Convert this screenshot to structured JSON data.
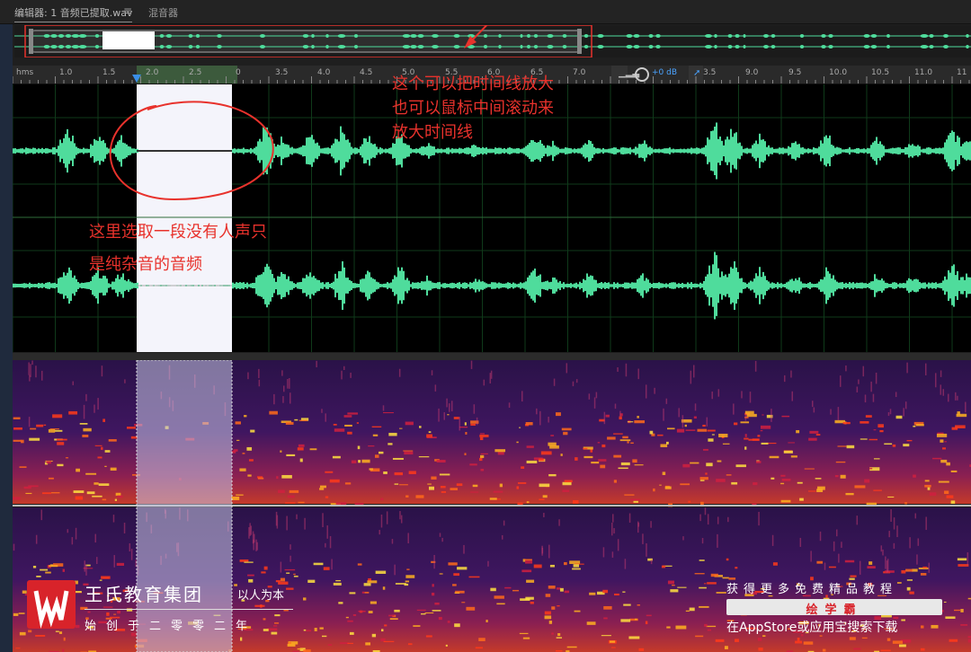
{
  "tabs": {
    "editor_label": "编辑器: 1 音频已提取.wav",
    "menu_glyph": "≡",
    "mixer_label": "混音器"
  },
  "ruler": {
    "unit": "hms",
    "ticks": [
      "1.0",
      "1.5",
      "2.0",
      "2.5",
      "0",
      "3.5",
      "4.0",
      "4.5",
      "5.0",
      "5.5",
      "6.0",
      "6.5",
      "7.0",
      "3.5",
      "9.0",
      "9.5",
      "10.0",
      "10.5",
      "11.0",
      "11"
    ],
    "volume_label": "+0 dB"
  },
  "annotations": {
    "zoom_line1": "这个可以把时间线放大",
    "zoom_line2": "也可以鼠标中间滚动来",
    "zoom_line3": "放大时间线",
    "select_line1": "这里选取一段没有人声只",
    "select_line2": "是纯杂音的音频"
  },
  "watermark": {
    "org_name": "王氏教育集团",
    "motto": "以人为本",
    "founded": "始创于二零零二年",
    "promo": "获得更多免费精品教程",
    "badge": "绘学霸",
    "store_line": "在AppStore或应用宝搜索下载"
  },
  "colors": {
    "waveform": "#4fdc9c",
    "annotation": "#e8322c",
    "selection": "#f4f4fb",
    "brand_red": "#d8232a"
  },
  "icons": {
    "volume": "volume-meter-icon",
    "knob": "volume-knob-icon",
    "pin": "pin-icon",
    "arrow": "annotation-arrow-icon"
  }
}
